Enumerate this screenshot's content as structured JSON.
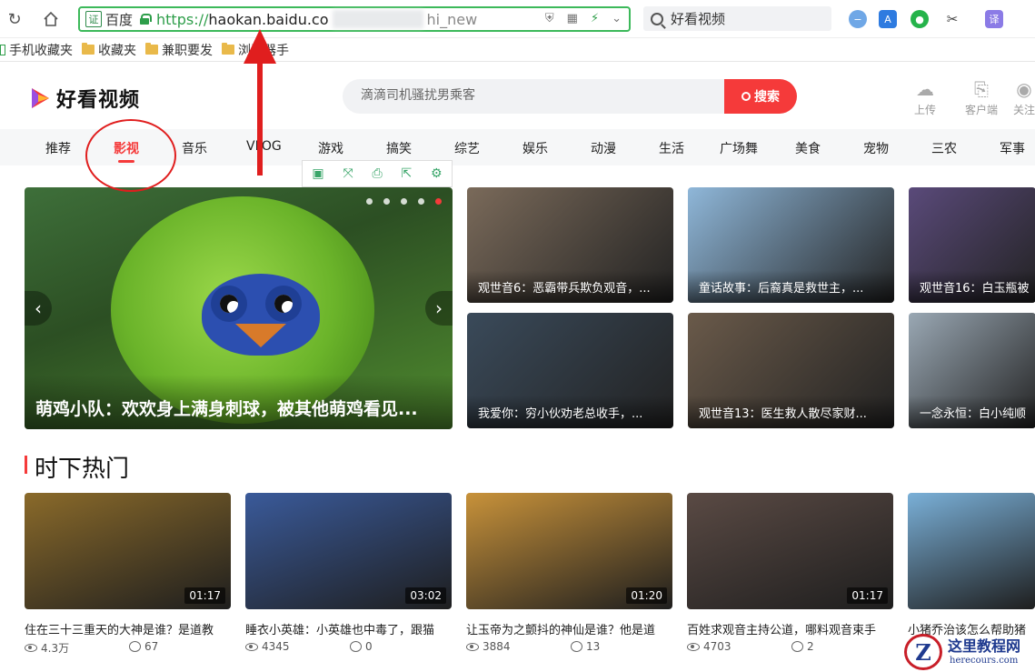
{
  "browser": {
    "address": {
      "cert_label": "证",
      "engine": "百度",
      "scheme": "https://",
      "host": "haokan.baidu.co",
      "tail": "hi_new"
    },
    "search_text": "好看视频",
    "ext_translate": "译"
  },
  "bookmarks": [
    "手机收藏夹",
    "收藏夹",
    "兼职要发",
    "浏览器手"
  ],
  "site": {
    "logo_text": "好看视频",
    "search_placeholder": "滴滴司机骚扰男乘客",
    "search_button": "搜索",
    "actions": [
      "上传",
      "客户端",
      "关注"
    ]
  },
  "categories": [
    "推荐",
    "影视",
    "音乐",
    "VLOG",
    "游戏",
    "搞笑",
    "综艺",
    "娱乐",
    "动漫",
    "生活",
    "广场舞",
    "美食",
    "宠物",
    "三农",
    "军事"
  ],
  "active_category": "影视",
  "hero": {
    "title": "萌鸡小队：欢欢身上满身刺球，被其他萌鸡看见..."
  },
  "featured": [
    {
      "title": "观世音6：恶霸带兵欺负观音，...",
      "color": "#7a6a5a"
    },
    {
      "title": "童话故事：后裔真是救世主，...",
      "color": "#8fb7d9"
    },
    {
      "title": "观世音16：白玉瓶被",
      "color": "#5a4a7a"
    },
    {
      "title": "我爱你：穷小伙劝老总收手，...",
      "color": "#3a4a5a"
    },
    {
      "title": "观世音13：医生救人散尽家财...",
      "color": "#6a5a4a"
    },
    {
      "title": "一念永恒：白小纯顺",
      "color": "#9aa8b4"
    }
  ],
  "section": {
    "title": "时下热门"
  },
  "videos": [
    {
      "title": "住在三十三重天的大神是谁？是道教",
      "duration": "01:17",
      "views": "4.3万",
      "comments": "67",
      "color": "#8a6a2a"
    },
    {
      "title": "睡衣小英雄：小英雄也中毒了，跟猫",
      "duration": "03:02",
      "views": "4345",
      "comments": "0",
      "color": "#3a5a9a"
    },
    {
      "title": "让玉帝为之颤抖的神仙是谁？他是道",
      "duration": "01:20",
      "views": "3884",
      "comments": "13",
      "color": "#c8923a"
    },
    {
      "title": "百姓求观音主持公道，哪料观音束手",
      "duration": "01:17",
      "views": "4703",
      "comments": "2",
      "color": "#5a4a44"
    },
    {
      "title": "小猪乔治该怎么帮助猪",
      "duration": "",
      "views": "",
      "comments": "",
      "color": "#7ab0d8"
    }
  ],
  "mini_tools": [
    "▣",
    "⤧",
    "⎙",
    "⇱",
    "⚙"
  ],
  "watermark": {
    "logo": "Z",
    "name": "这里教程网",
    "url": "herecours.com"
  }
}
